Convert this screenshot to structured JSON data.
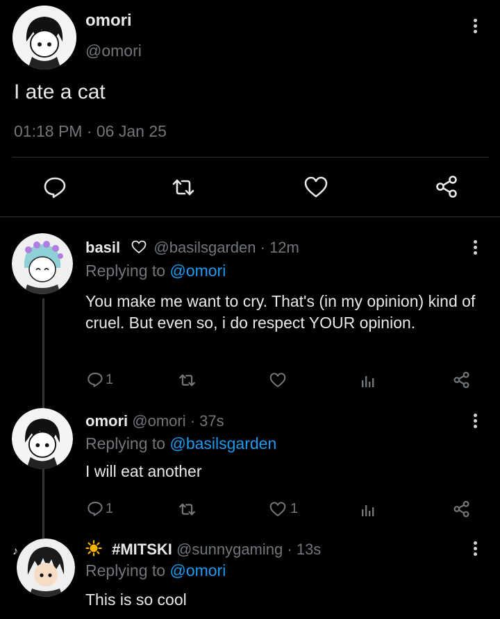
{
  "main_post": {
    "display_name": "omori",
    "handle": "@omori",
    "text": "I ate a cat",
    "timestamp": "01:18 PM · 06 Jan 25"
  },
  "replies": [
    {
      "display_name": "basil",
      "badge_icon": "heart-outline-icon",
      "handle": "@basilsgarden",
      "separator": "·",
      "time": "12m",
      "replying_prefix": "Replying to",
      "replying_to": "@omori",
      "text": "You make me want to cry. That's (in my opinion) kind of cruel. But even so, i do respect YOUR opinion.",
      "reply_count": "1",
      "like_count": ""
    },
    {
      "display_name": "omori",
      "handle": "@omori",
      "separator": "·",
      "time": "37s",
      "replying_prefix": "Replying to",
      "replying_to": "@basilsgarden",
      "text": "I will eat another",
      "reply_count": "1",
      "like_count": "1"
    },
    {
      "name_icon": "sun-icon",
      "display_name": "#MITSKI",
      "handle": "@sunnygaming",
      "separator": "·",
      "time": "13s",
      "replying_prefix": "Replying to",
      "replying_to": "@omori",
      "text": "This is so cool"
    }
  ],
  "colors": {
    "background": "#000000",
    "text": "#e7e9ea",
    "muted": "#71767b",
    "link": "#1d9bf0",
    "divider": "#2f3336",
    "sun": "#f5b400"
  }
}
